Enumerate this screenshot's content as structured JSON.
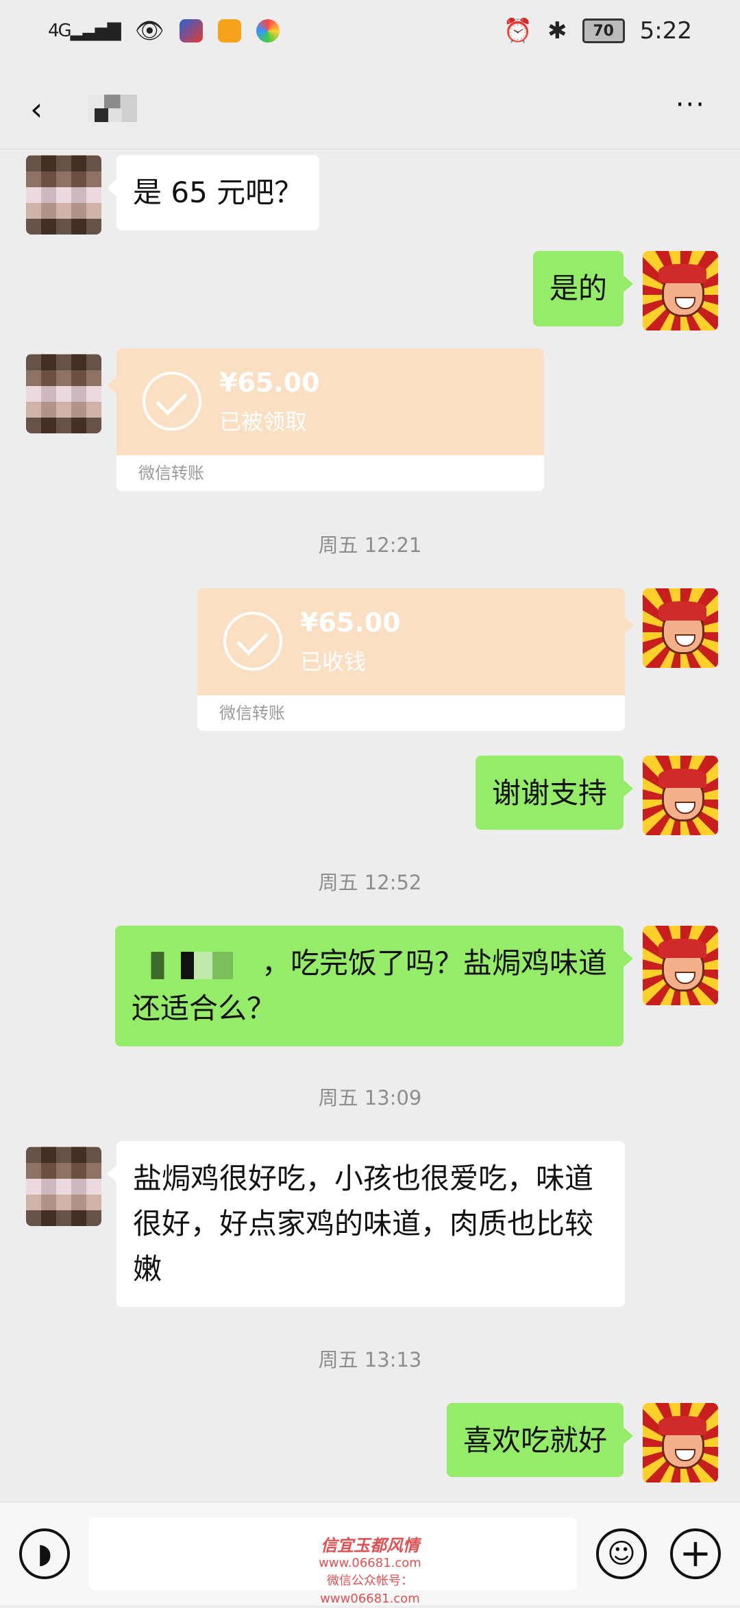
{
  "status_bar": {
    "network": "4G",
    "battery": "70",
    "time": "5:22"
  },
  "header": {
    "back_icon": "back-arrow",
    "more_icon": "more-dots"
  },
  "messages": {
    "m1": {
      "text": "是 65 元吧？"
    },
    "m2": {
      "text": "是的"
    },
    "m3": {
      "amount": "¥65.00",
      "status": "已被领取",
      "footer": "微信转账"
    },
    "time1": "周五 12:21",
    "m4": {
      "amount": "¥65.00",
      "status": "已收钱",
      "footer": "微信转账"
    },
    "m5": {
      "text": "谢谢支持"
    },
    "time2": "周五 12:52",
    "m6": {
      "text_after_redaction": "，吃完饭了吗？盐焗鸡味道",
      "text_line2": "还适合么？"
    },
    "time3": "周五 13:09",
    "m7": {
      "text": "盐焗鸡很好吃，小孩也很爱吃，味道很好，好点家鸡的味道，肉质也比较嫩"
    },
    "time4": "周五 13:13",
    "m8": {
      "text": "喜欢吃就好"
    }
  },
  "input_bar": {
    "watermark_title": "信宜玉都风情",
    "watermark_url": "www.06681.com",
    "watermark_sub": "微信公众帐号：www06681.com"
  }
}
